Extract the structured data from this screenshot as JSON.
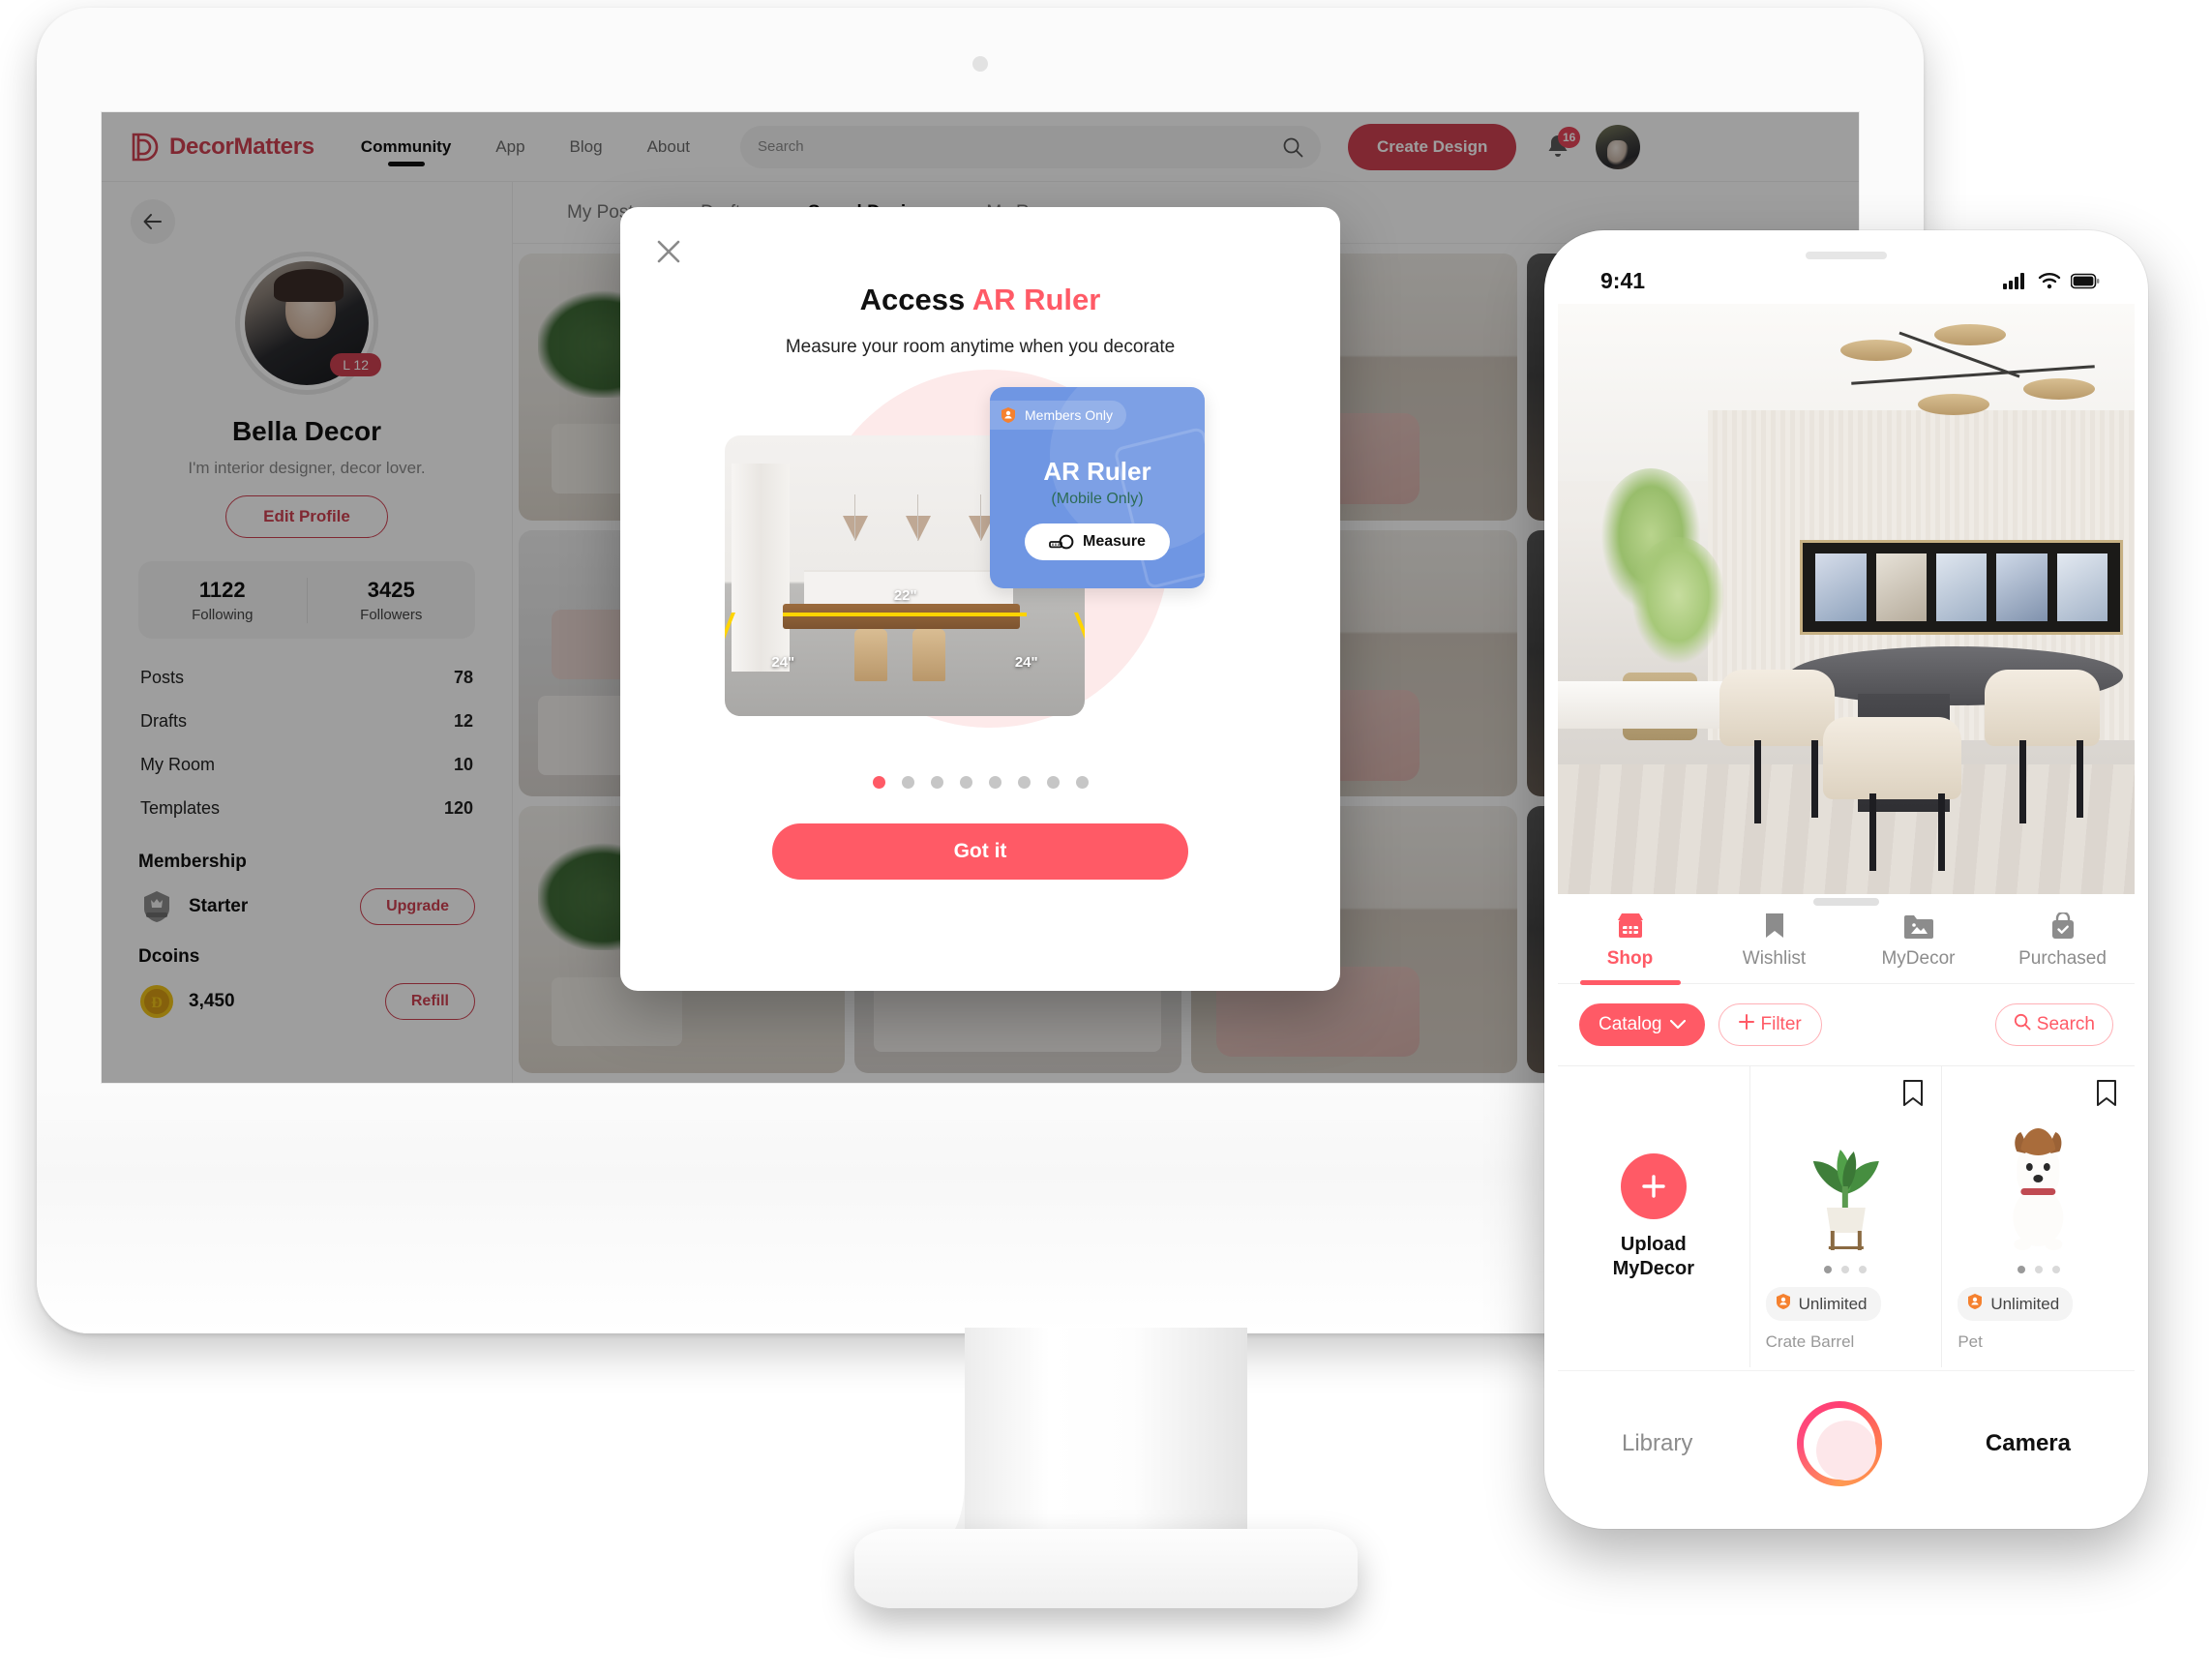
{
  "desktop": {
    "header": {
      "brand": "DecorMatters",
      "nav": [
        {
          "label": "Community",
          "active": true
        },
        {
          "label": "App",
          "active": false
        },
        {
          "label": "Blog",
          "active": false
        },
        {
          "label": "About",
          "active": false
        }
      ],
      "search_placeholder": "Search",
      "search_value": "",
      "create_design_label": "Create Design",
      "notification_count": "16",
      "icons": {
        "search": "search-icon",
        "bell": "bell-icon",
        "avatar": "avatar"
      }
    },
    "sidebar": {
      "back_icon": "back-arrow-icon",
      "level_badge": "L 12",
      "name": "Bella Decor",
      "bio": "I'm interior designer, decor lover.",
      "edit_profile_label": "Edit Profile",
      "follow": [
        {
          "value": "1122",
          "label": "Following"
        },
        {
          "value": "3425",
          "label": "Followers"
        }
      ],
      "stats": [
        {
          "label": "Posts",
          "value": "78"
        },
        {
          "label": "Drafts",
          "value": "12"
        },
        {
          "label": "My Room",
          "value": "10"
        },
        {
          "label": "Templates",
          "value": "120"
        }
      ],
      "membership": {
        "heading": "Membership",
        "tier": "Starter",
        "action_label": "Upgrade"
      },
      "dcoins": {
        "heading": "Dcoins",
        "balance": "3,450",
        "action_label": "Refill"
      }
    },
    "content": {
      "tabs": [
        {
          "label": "My Posts",
          "active": false
        },
        {
          "label": "Drafts",
          "active": false
        },
        {
          "label": "Saved Design",
          "active": true
        },
        {
          "label": "My Room",
          "active": false
        }
      ]
    },
    "modal": {
      "close_icon": "close-icon",
      "title_prefix": "Access ",
      "title_accent": "AR Ruler",
      "subtitle": "Measure your room anytime when you decorate",
      "card": {
        "members_only_label": "Members Only",
        "title": "AR Ruler",
        "subtitle": "(Mobile Only)",
        "measure_label": "Measure",
        "measure_icon": "tape-measure-icon",
        "background_color": "#6f96e3"
      },
      "measurements": [
        {
          "label": "22\"",
          "position": "top"
        },
        {
          "label": "24\"",
          "position": "left"
        },
        {
          "label": "24\"",
          "position": "right"
        }
      ],
      "carousel": {
        "total": 8,
        "active_index": 0
      },
      "primary_button_label": "Got it",
      "accent_color": "#ff5a66"
    }
  },
  "phone": {
    "status": {
      "time": "9:41",
      "signal": "signal-icon",
      "wifi": "wifi-icon",
      "battery": "battery-icon"
    },
    "tabs": [
      {
        "label": "Shop",
        "icon": "store-icon",
        "active": true
      },
      {
        "label": "Wishlist",
        "icon": "bookmark-icon",
        "active": false
      },
      {
        "label": "MyDecor",
        "icon": "photo-folder-icon",
        "active": false
      },
      {
        "label": "Purchased",
        "icon": "shopping-bag-check-icon",
        "active": false
      }
    ],
    "filters": {
      "catalog_label": "Catalog",
      "catalog_chevron": "chevron-down-icon",
      "filter_label": "Filter",
      "filter_icon": "plus-icon",
      "search_label": "Search",
      "search_icon": "search-icon"
    },
    "products": [
      {
        "type": "upload",
        "label_line1": "Upload",
        "label_line2": "MyDecor",
        "icon": "plus-icon"
      },
      {
        "type": "item",
        "name": "Crate Barrel",
        "badge": "Unlimited",
        "dots": 3,
        "active_dot": 0,
        "image": "potted-plant"
      },
      {
        "type": "item",
        "name": "Pet",
        "badge": "Unlimited",
        "dots": 3,
        "active_dot": 0,
        "image": "puppy"
      }
    ],
    "bottom": {
      "library_label": "Library",
      "camera_label": "Camera",
      "shutter_icon": "shutter-button"
    }
  }
}
